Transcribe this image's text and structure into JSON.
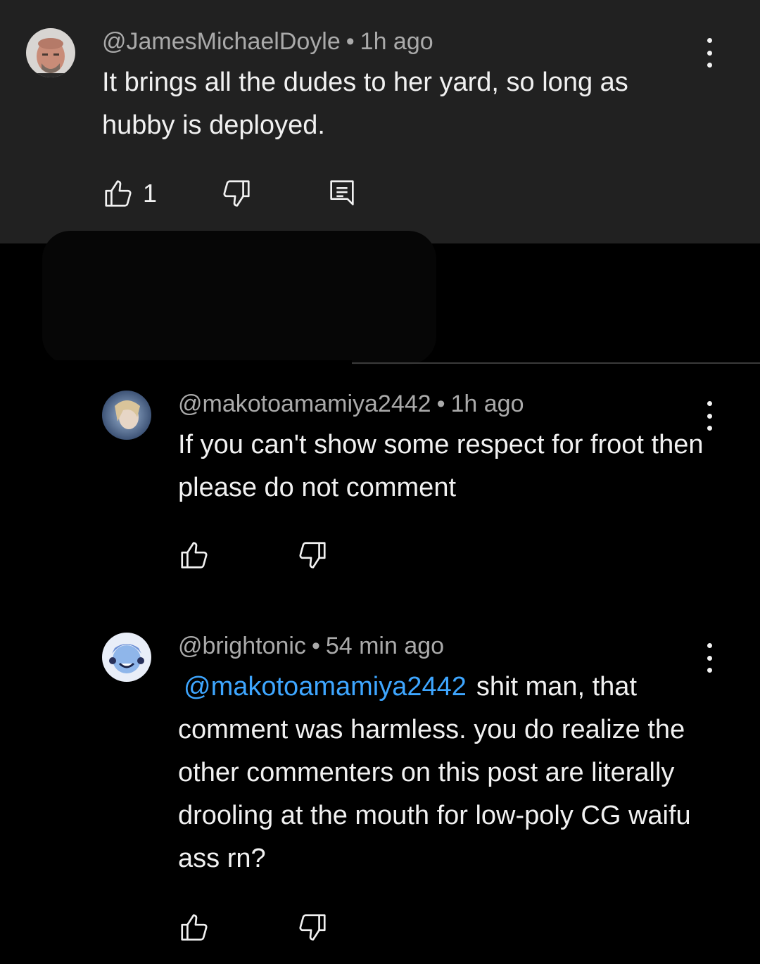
{
  "comments": [
    {
      "author": "@JamesMichaelDoyle",
      "time": "1h ago",
      "text": "It brings all the dudes to her yard, so long as hubby is deployed.",
      "likes": "1"
    },
    {
      "author": "@makotoamamiya2442",
      "time": "1h ago",
      "text": "If you can't show some respect for froot then please do not comment"
    },
    {
      "author": "@brightonic",
      "time": "54 min ago",
      "mention": "@makotoamamiya2442",
      "text": "shit man, that comment was harmless. you do realize the other commenters on this post are literally drooling at the mouth for low-poly CG waifu ass rn?"
    }
  ],
  "separator": "•",
  "icons": [
    "like-icon",
    "dislike-icon",
    "reply-icon",
    "more-options-icon"
  ],
  "colors": {
    "mention": "#3ea6ff",
    "meta": "#aaaaaa",
    "panel": "#212121",
    "background": "#000000"
  }
}
